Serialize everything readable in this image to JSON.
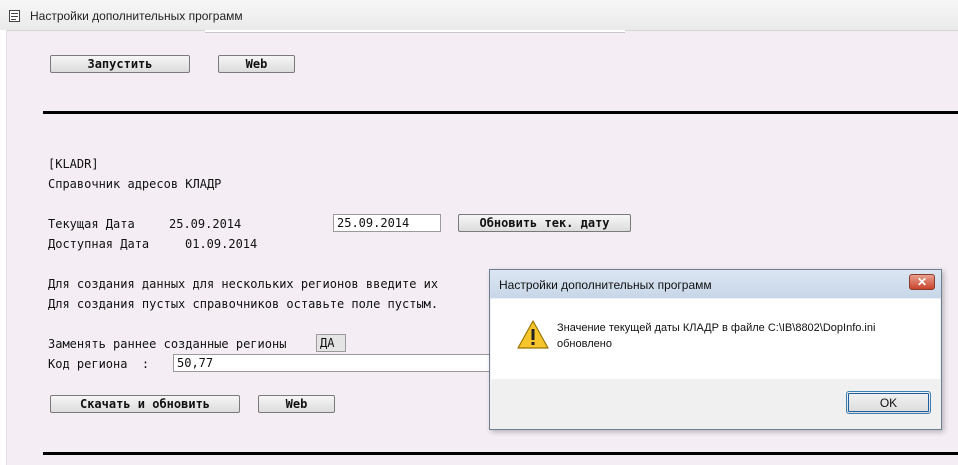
{
  "window": {
    "title": "Настройки дополнительных программ"
  },
  "top_section": {
    "run_button": "Запустить",
    "web_button": "Web"
  },
  "kladr": {
    "section_tag": "[KLADR]",
    "heading": "Справочник адресов КЛАДР",
    "current_date_label": "Текущая Дата",
    "current_date_value": "25.09.2014",
    "current_date_input": "25.09.2014",
    "update_date_button": "Обновить тек. дату",
    "available_date_label": "Доступная Дата",
    "available_date_value": "01.09.2014",
    "hint_line1": "Для создания данных для нескольких регионов введите их",
    "hint_line2": "Для создания пустых справочников оставьте поле пустым.",
    "replace_label": "Заменять раннее созданные регионы",
    "replace_value": "ДА",
    "region_code_label": "Код региона  :",
    "region_code_value": "50,77",
    "download_button": "Скачать и обновить",
    "web_button": "Web"
  },
  "dialog": {
    "title": "Настройки дополнительных программ",
    "close": "✕",
    "icon": "warning-icon",
    "message_line1": "Значение текущей даты КЛАДР в файле C:\\IB\\8802\\DopInfo.ini",
    "message_line2": "обновлено",
    "ok_button": "OK"
  }
}
